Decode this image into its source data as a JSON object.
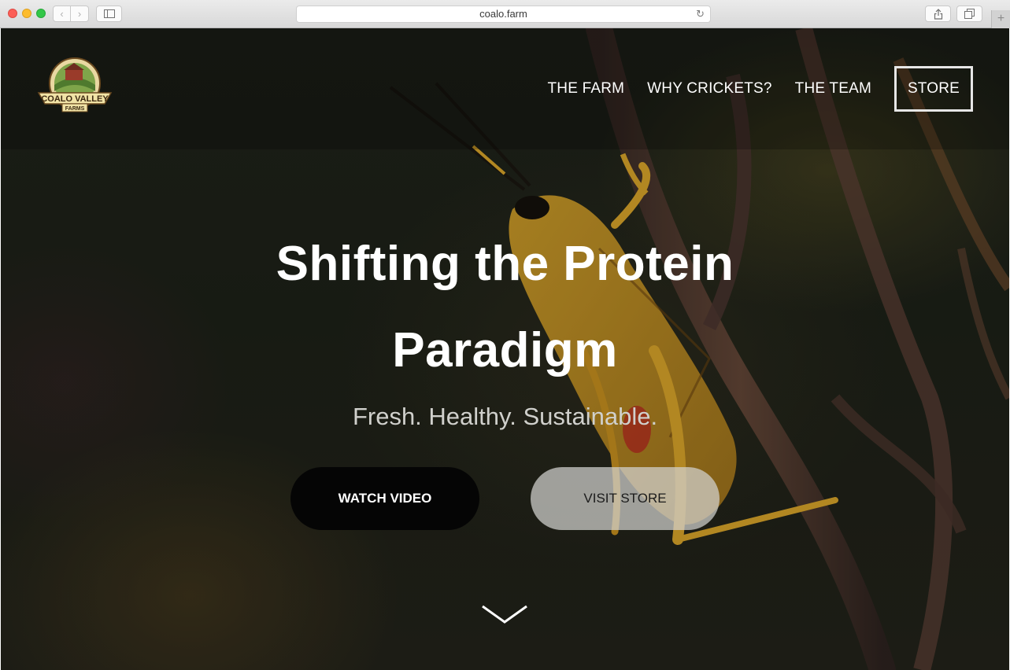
{
  "browser": {
    "url": "coalo.farm",
    "back_icon": "chevron-left-icon",
    "forward_icon": "chevron-right-icon",
    "reload_icon": "reload-icon",
    "newtab_label": "+"
  },
  "site": {
    "logo_icon": "coalo-valley-farms-logo",
    "nav": {
      "farm": "THE FARM",
      "crickets": "WHY CRICKETS?",
      "team": "THE TEAM",
      "store": "STORE"
    },
    "hero": {
      "headline_line1": "Shifting the Protein",
      "headline_line2": "Paradigm",
      "tagline": "Fresh. Healthy. Sustainable.",
      "watch_video": "WATCH VIDEO",
      "visit_store": "VISIT STORE",
      "scroll_icon": "chevron-down-icon"
    }
  }
}
